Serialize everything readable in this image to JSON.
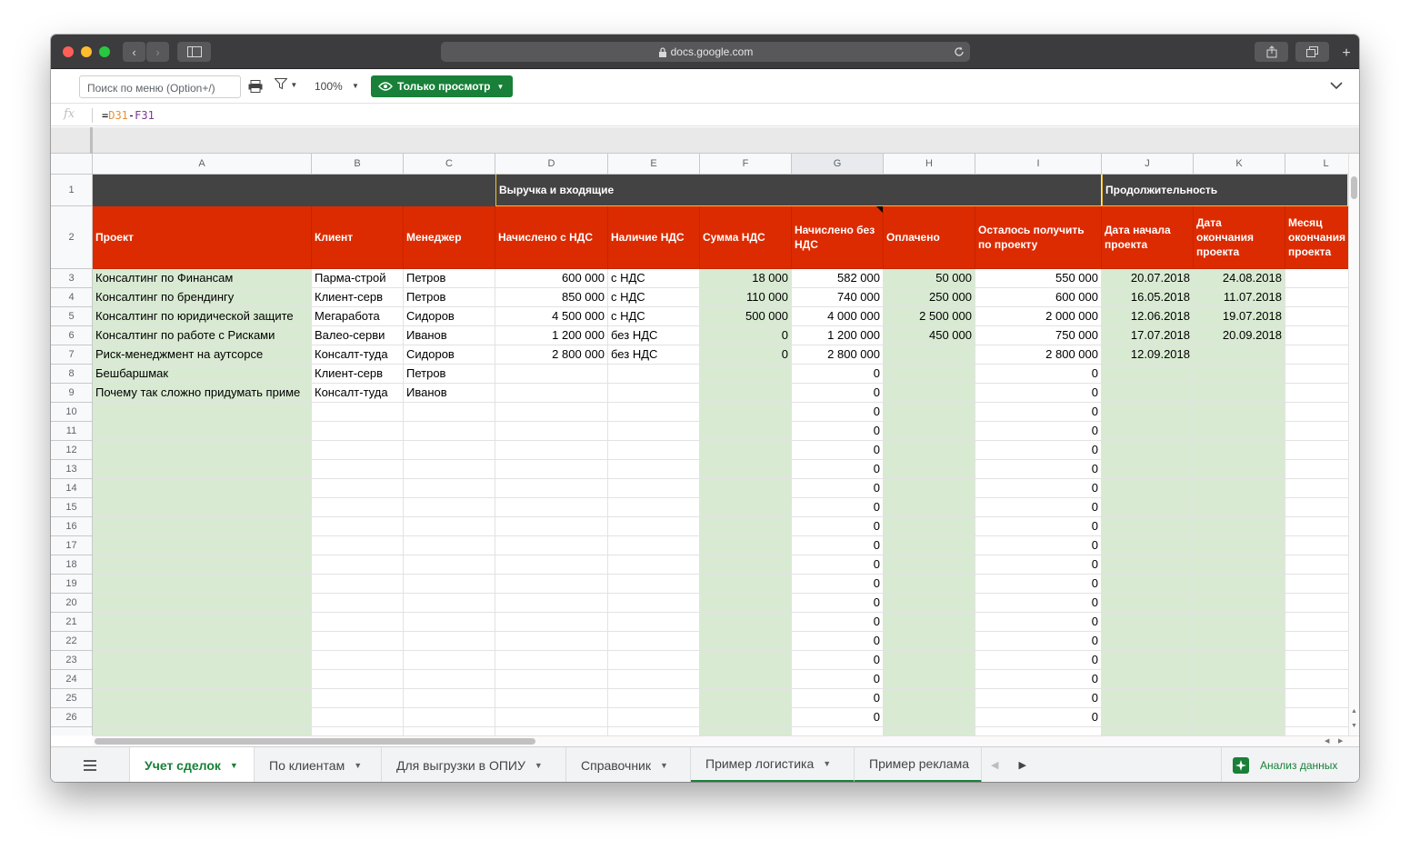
{
  "browser": {
    "url": "docs.google.com"
  },
  "toolbar": {
    "menu_search_placeholder": "Поиск по меню (Option+/)",
    "zoom": "100%",
    "view_mode": "Только просмотр"
  },
  "formula": {
    "fx": "fx",
    "eq": "=",
    "ref1": "D31",
    "op": "-",
    "ref2": "F31"
  },
  "columns": [
    "A",
    "B",
    "C",
    "D",
    "E",
    "F",
    "G",
    "H",
    "I",
    "J",
    "K",
    "L"
  ],
  "group_headers": {
    "revenue": "Выручка и входящие",
    "duration": "Продолжительность"
  },
  "headers": [
    "Проект",
    "Клиент",
    "Менеджер",
    "Начислено с НДС",
    "Наличие НДС",
    "Сумма НДС",
    "Начислено без НДС",
    "Оплачено",
    "Осталось получить по проекту",
    "Дата начала проекта",
    "Дата окончания проекта",
    "Месяц окончания проекта"
  ],
  "rows": [
    [
      "Консалтинг по Финансам",
      "Парма-строй",
      "Петров",
      "600 000",
      "с НДС",
      "18 000",
      "582 000",
      "50 000",
      "550 000",
      "20.07.2018",
      "24.08.2018",
      ""
    ],
    [
      "Консалтинг по брендингу",
      "Клиент-серв",
      "Петров",
      "850 000",
      "с НДС",
      "110 000",
      "740 000",
      "250 000",
      "600 000",
      "16.05.2018",
      "11.07.2018",
      ""
    ],
    [
      "Консалтинг по юридической защите",
      "Мегаработа",
      "Сидоров",
      "4 500 000",
      "с НДС",
      "500 000",
      "4 000 000",
      "2 500 000",
      "2 000 000",
      "12.06.2018",
      "19.07.2018",
      ""
    ],
    [
      "Консалтинг по работе с Рисками",
      "Валео-серви",
      "Иванов",
      "1 200 000",
      "без НДС",
      "0",
      "1 200 000",
      "450 000",
      "750 000",
      "17.07.2018",
      "20.09.2018",
      ""
    ],
    [
      "Риск-менеджмент на аутсорсе",
      "Консалт-туда",
      "Сидоров",
      "2 800 000",
      "без НДС",
      "0",
      "2 800 000",
      "",
      "2 800 000",
      "12.09.2018",
      "",
      ""
    ],
    [
      "Бешбаршмак",
      "Клиент-серв",
      "Петров",
      "",
      "",
      "",
      "0",
      "",
      "0",
      "",
      "",
      ""
    ],
    [
      "Почему так сложно придумать приме",
      "Консалт-туда",
      "Иванов",
      "",
      "",
      "",
      "0",
      "",
      "0",
      "",
      "",
      ""
    ]
  ],
  "empty_row_numbers": [
    "10",
    "11",
    "12",
    "13",
    "14",
    "15",
    "16",
    "17",
    "18",
    "19",
    "20",
    "21",
    "22",
    "23",
    "24",
    "25",
    "26"
  ],
  "empty_row_values": {
    "g": "0",
    "i": "0"
  },
  "sheet_tabs": [
    {
      "label": "Учет сделок",
      "active": true
    },
    {
      "label": "По клиентам"
    },
    {
      "label": "Для выгрузки в ОПИУ"
    },
    {
      "label": "Справочник"
    },
    {
      "label": "Пример логистика"
    },
    {
      "label": "Пример реклама"
    }
  ],
  "explore_label": "Анализ данных",
  "colors": {
    "header_red": "#dc2b00",
    "group_dark": "#434343",
    "green_fill": "#d9ead3",
    "accent_yellow": "#f1c232",
    "sheets_green": "#188038"
  }
}
